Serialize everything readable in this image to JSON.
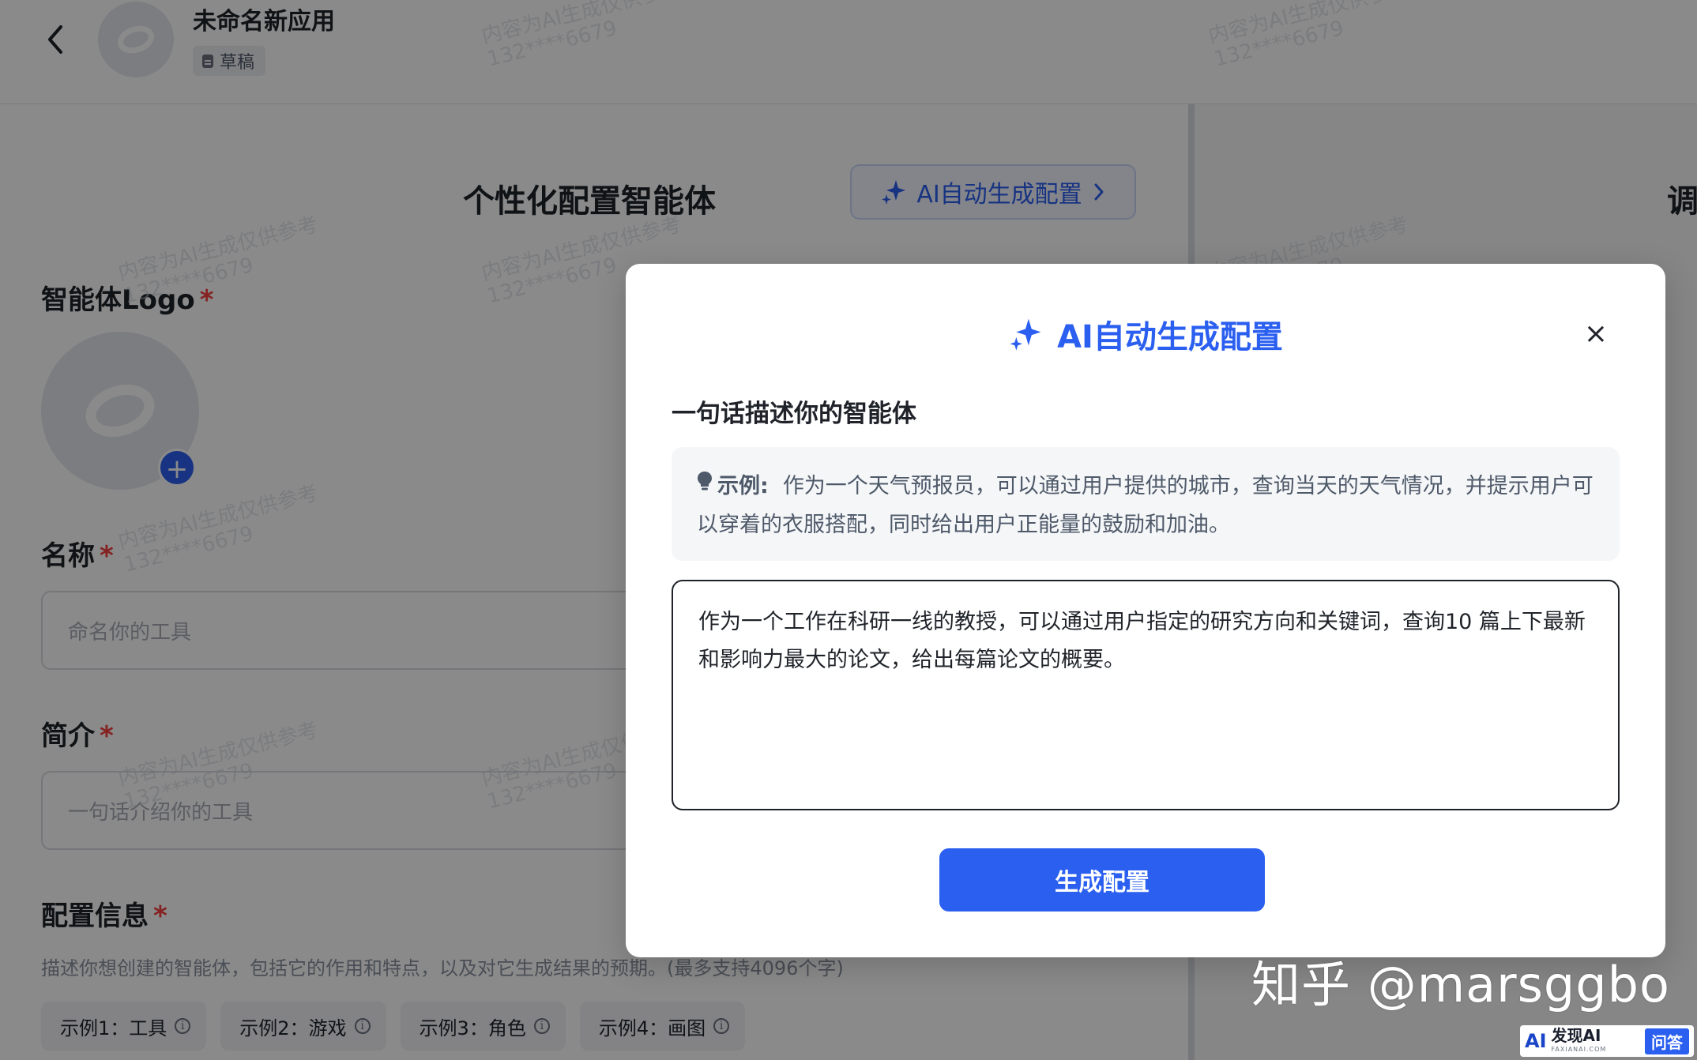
{
  "header": {
    "app_title": "未命名新应用",
    "status_badge": "草稿"
  },
  "left_panel": {
    "heading": "个性化配置智能体",
    "ai_button_label": "AI自动生成配置",
    "logo_label": "智能体Logo",
    "name_label": "名称",
    "name_placeholder": "命名你的工具",
    "intro_label": "简介",
    "intro_placeholder": "一句话介绍你的工具",
    "config_label": "配置信息",
    "config_description": "描述你想创建的智能体，包括它的作用和特点，以及对它生成结果的预期。(最多支持4096个字)",
    "required_mark": "*",
    "examples": [
      {
        "label": "示例1：工具"
      },
      {
        "label": "示例2：游戏"
      },
      {
        "label": "示例3：角色"
      },
      {
        "label": "示例4：画图"
      }
    ]
  },
  "right_panel": {
    "heading_fragment": "调"
  },
  "modal": {
    "title": "AI自动生成配置",
    "close_icon": "×",
    "field_label": "一句话描述你的智能体",
    "example_label": "示例:",
    "example_text": "作为一个天气预报员，可以通过用户提供的城市，查询当天的天气情况，并提示用户可以穿着的衣服搭配，同时给出用户正能量的鼓励和加油。",
    "input_value": "作为一个工作在科研一线的教授，可以通过用户指定的研究方向和关键词，查询10 篇上下最新和影响力最大的论文，给出每篇论文的概要。",
    "generate_button": "生成配置"
  },
  "watermark": {
    "line1": "内容为AI生成仅供参考",
    "line2": "132****6679"
  },
  "branding": {
    "zhihu": "知乎 @marsggbo",
    "badge_logo": "AI",
    "badge_name": "发现AI",
    "badge_domain": "FAXIANAI.COM",
    "badge_tag": "问答"
  },
  "colors": {
    "accent": "#2b5ff0",
    "required": "#f53f3f",
    "overlay": "rgba(0,0,0,0.46)"
  },
  "icons": {
    "back": "chevron-left-icon",
    "sparkle": "sparkle-icon",
    "close": "close-icon",
    "bulb": "lightbulb-icon",
    "info": "info-icon",
    "add": "plus-icon",
    "document": "document-icon"
  }
}
